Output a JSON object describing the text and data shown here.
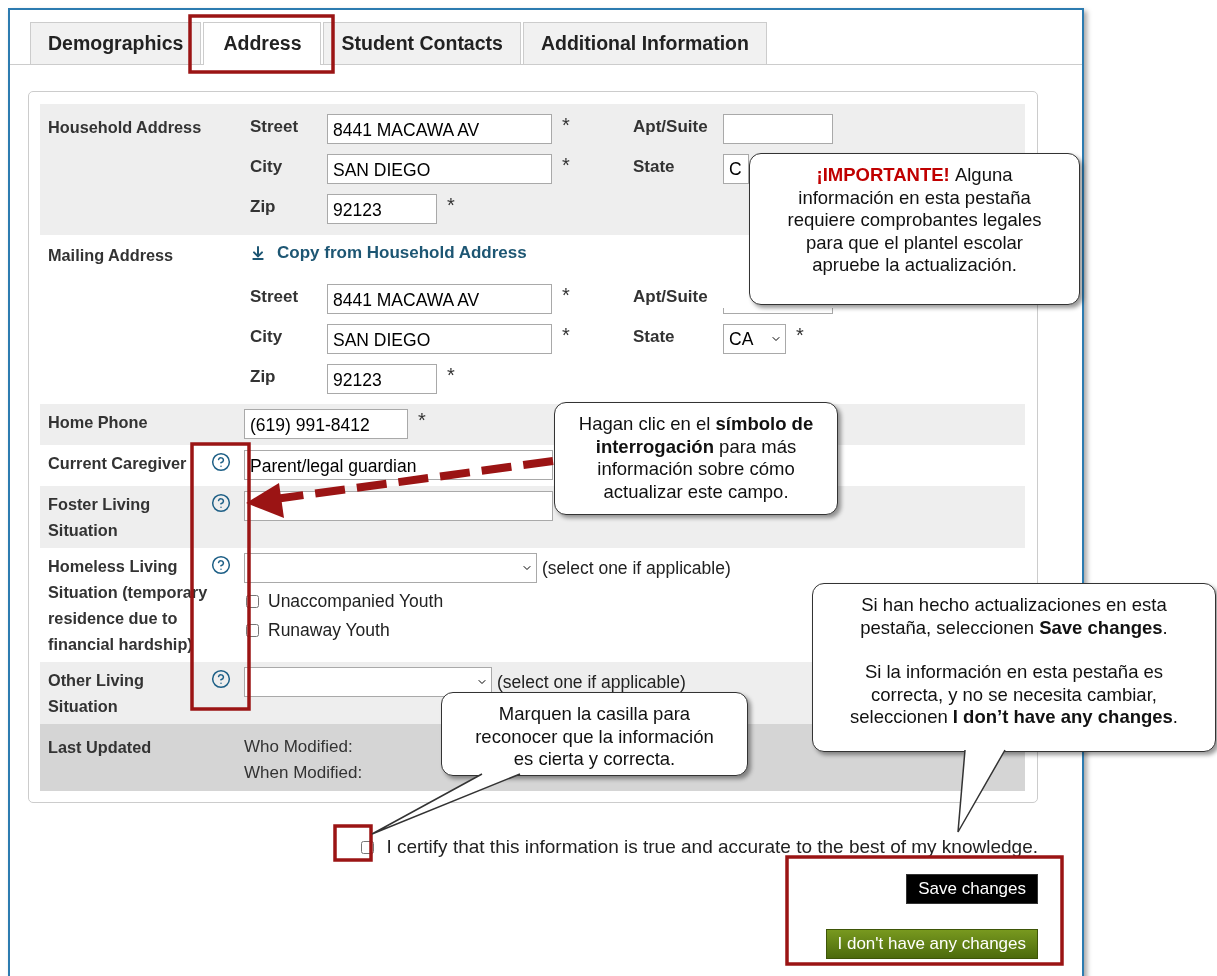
{
  "tabs": [
    {
      "label": "Demographics",
      "selected": false
    },
    {
      "label": "Address",
      "selected": true
    },
    {
      "label": "Student Contacts",
      "selected": false
    },
    {
      "label": "Additional Information",
      "selected": false
    }
  ],
  "rows": [
    {
      "kind": "address",
      "label": "Household Address",
      "lines": [
        [
          {
            "label": "Street",
            "kind": "text",
            "value": "8441 MACAWA AV",
            "required": "*"
          },
          {
            "label": "Apt/Suite",
            "kind": "text"
          }
        ],
        [
          {
            "label": "City",
            "kind": "text",
            "value": "SAN DIEGO",
            "required": "*"
          },
          {
            "label": "State",
            "kind": "select",
            "value": "C"
          }
        ],
        [
          {
            "label": "Zip",
            "kind": "short",
            "value": "92123",
            "required": "*"
          }
        ]
      ]
    },
    {
      "kind": "address",
      "label": "Mailing Address",
      "link": "Copy from Household Address",
      "lines": [
        [
          {
            "label": "Street",
            "kind": "text",
            "value": "8441 MACAWA AV",
            "required": "*"
          },
          {
            "label": "Apt/Suite",
            "kind": "text"
          }
        ],
        [
          {
            "label": "City",
            "kind": "text",
            "value": "SAN DIEGO",
            "required": "*"
          },
          {
            "label": "State",
            "kind": "select",
            "value": "CA",
            "required": "*"
          }
        ],
        [
          {
            "label": "Zip",
            "kind": "short",
            "value": "92123",
            "required": "*"
          }
        ]
      ]
    },
    {
      "kind": "input",
      "label": "Home Phone",
      "value": "(619) 991-8412",
      "required": "*"
    },
    {
      "kind": "input",
      "label": "Current Caregiver",
      "value": "Parent/legal guardian",
      "help": true
    },
    {
      "kind": "select",
      "label": "Foster Living Situation",
      "help": true
    },
    {
      "kind": "select",
      "label": "Homeless Living Situation (temporary residence due to financial hardship)",
      "help": true,
      "note": "(select one if applicable)",
      "options": [
        {
          "label": "Unaccompanied Youth",
          "checked": false
        },
        {
          "label": "Runaway Youth",
          "checked": false
        }
      ]
    },
    {
      "kind": "select",
      "label": "Other Living Situation",
      "help": true,
      "note": "(select one if applicable)"
    },
    {
      "kind": "updated",
      "label": "Last Updated",
      "lines": [
        "Who Modified:",
        "When Modified:"
      ]
    }
  ],
  "certify": {
    "checked": false,
    "text": "I certify that this information is true and accurate to the best of my knowledge."
  },
  "buttons": [
    {
      "label": "Save changes",
      "kind": "primary"
    },
    {
      "label": "I don't have any changes",
      "kind": "secondary"
    }
  ],
  "callouts": [
    {
      "lead": "¡IMPORTANTE!",
      "paragraphs": [
        "Alguna información en esta pestaña requiere comprobantes legales para que el plantel escolar apruebe la actualización."
      ]
    },
    {
      "paragraphs": [
        "Hagan clic en el **símbolo de interrogación** para más información sobre cómo actualizar este campo."
      ]
    },
    {
      "paragraphs": [
        "Si han hecho actualizaciones en esta pestaña, seleccionen **Save changes**.",
        "Si la información en esta pestaña es correcta, y no se necesita cambiar, seleccionen **I don’t have any changes**."
      ]
    },
    {
      "paragraphs": [
        "Marquen la casilla para reconocer que la información es cierta y correcta."
      ]
    }
  ]
}
